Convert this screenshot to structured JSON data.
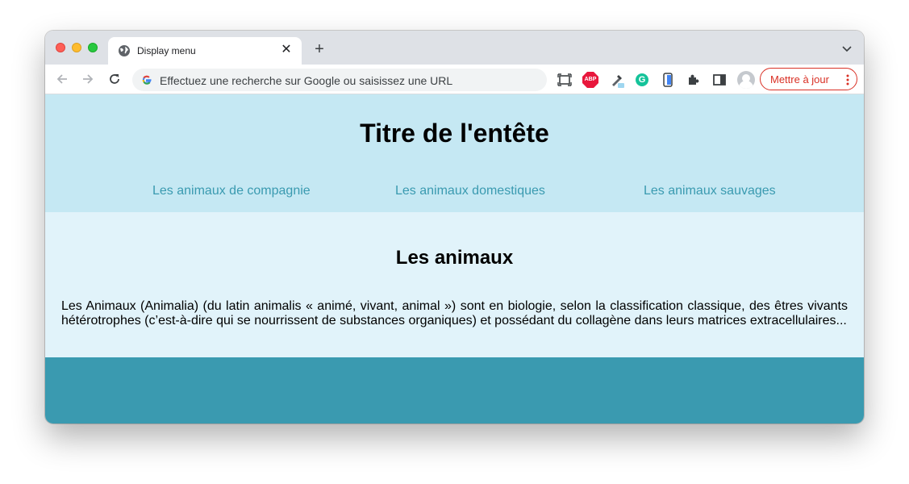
{
  "browser": {
    "tab_title": "Display menu",
    "omnibox_placeholder": "Effectuez une recherche sur Google ou saisissez une URL",
    "update_button_label": "Mettre à jour",
    "extensions": [
      "screen-capture-icon",
      "adblock-plus-icon",
      "eyedropper-icon",
      "grammarly-icon",
      "phone-mirror-icon",
      "puzzle-icon",
      "side-panel-icon"
    ]
  },
  "page": {
    "header_title": "Titre de l'entête",
    "nav": [
      {
        "label": "Les animaux de compagnie"
      },
      {
        "label": "Les animaux domestiques"
      },
      {
        "label": "Les animaux sauvages"
      }
    ],
    "section_title": "Les animaux",
    "section_text": "Les Animaux (Animalia) (du latin animalis « animé, vivant, animal ») sont en biologie, selon la classification classique, des êtres vivants hétérotrophes (c’est-à-dire qui se nourrissent de substances organiques) et possédant du collagène dans leurs matrices extracellulaires..."
  },
  "colors": {
    "header_bg": "#c5e8f3",
    "main_bg": "#e1f3fa",
    "footer_bg": "#3a9ab0",
    "link": "#3a9ab0",
    "update_red": "#d93025"
  }
}
